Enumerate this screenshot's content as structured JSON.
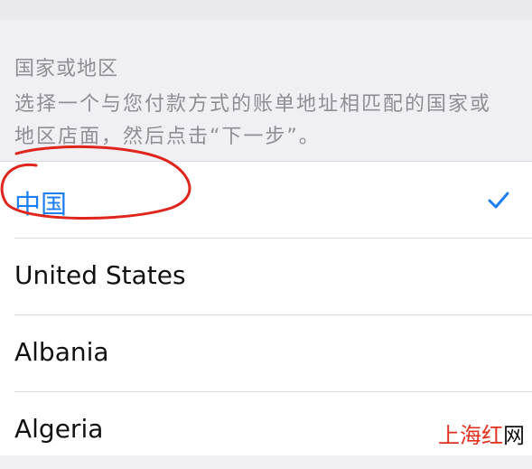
{
  "header": {
    "title": "国家或地区",
    "description": "选择一个与您付款方式的账单地址相匹配的国家或地区店面，然后点击“下一步”。"
  },
  "countries": [
    {
      "label": "中国",
      "selected": true
    },
    {
      "label": "United States",
      "selected": false
    },
    {
      "label": "Albania",
      "selected": false
    },
    {
      "label": "Algeria",
      "selected": false
    }
  ],
  "watermark": {
    "red_part": "上海红",
    "dark_part": "网"
  },
  "colors": {
    "accent": "#1b7ef4",
    "annotation": "#e0251c",
    "background": "#efeff4"
  }
}
